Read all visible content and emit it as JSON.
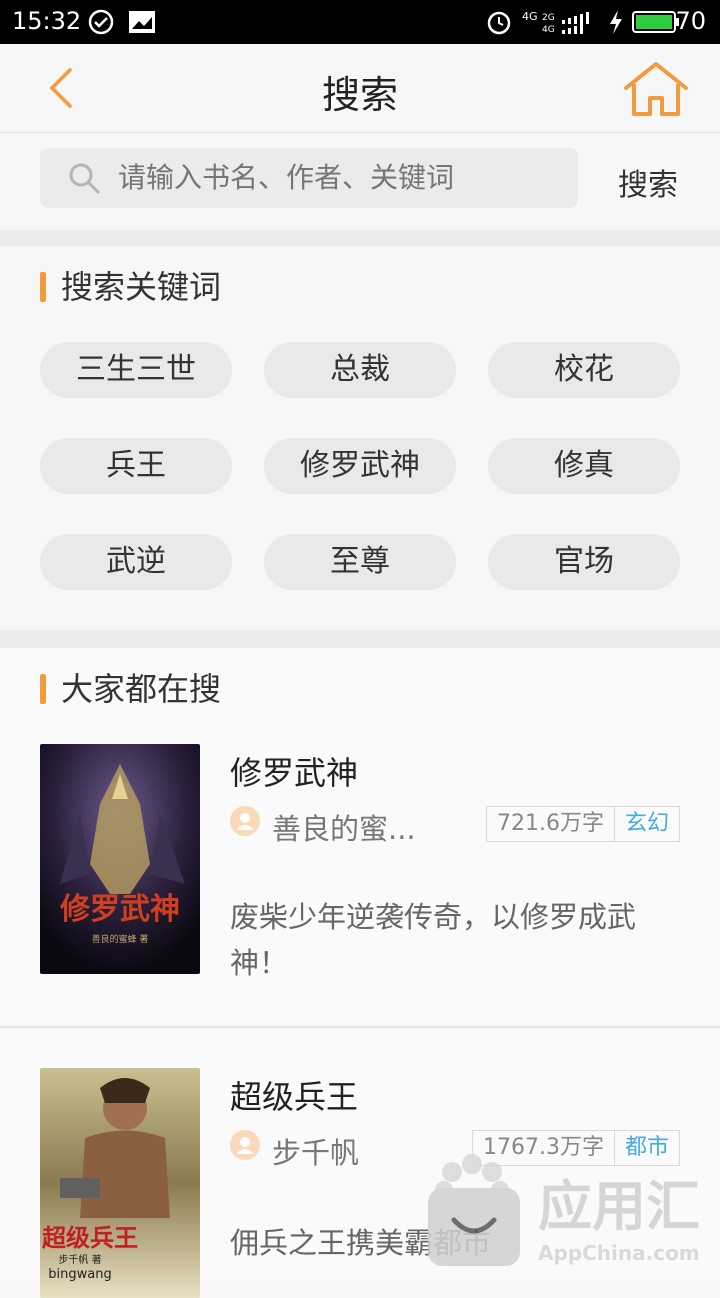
{
  "status": {
    "time": "15:32",
    "battery": "70"
  },
  "nav": {
    "title": "搜索"
  },
  "search": {
    "placeholder": "请输入书名、作者、关键词",
    "button_label": "搜索"
  },
  "keywords": {
    "title": "搜索关键词",
    "items": [
      "三生三世",
      "总裁",
      "校花",
      "兵王",
      "修罗武神",
      "修真",
      "武逆",
      "至尊",
      "官场"
    ]
  },
  "popular": {
    "title": "大家都在搜",
    "books": [
      {
        "title": "修罗武神",
        "author": "善良的蜜...",
        "words": "721.6万字",
        "category": "玄幻",
        "desc": "废柴少年逆袭传奇，以修罗成武神！",
        "cover_text": "修罗武神",
        "cover_author": "善良的蜜蜂 著"
      },
      {
        "title": "超级兵王",
        "author": "步千帆",
        "words": "1767.3万字",
        "category": "都市",
        "desc": "佣兵之王携美霸都市",
        "cover_text": "超级兵王",
        "cover_author": "步千帆 著",
        "cover_sub": "bingwang"
      }
    ]
  },
  "watermark": {
    "brand": "应用汇",
    "url": "AppChina.com"
  },
  "colors": {
    "accent": "#f39a3d",
    "category": "#46a9e0"
  }
}
